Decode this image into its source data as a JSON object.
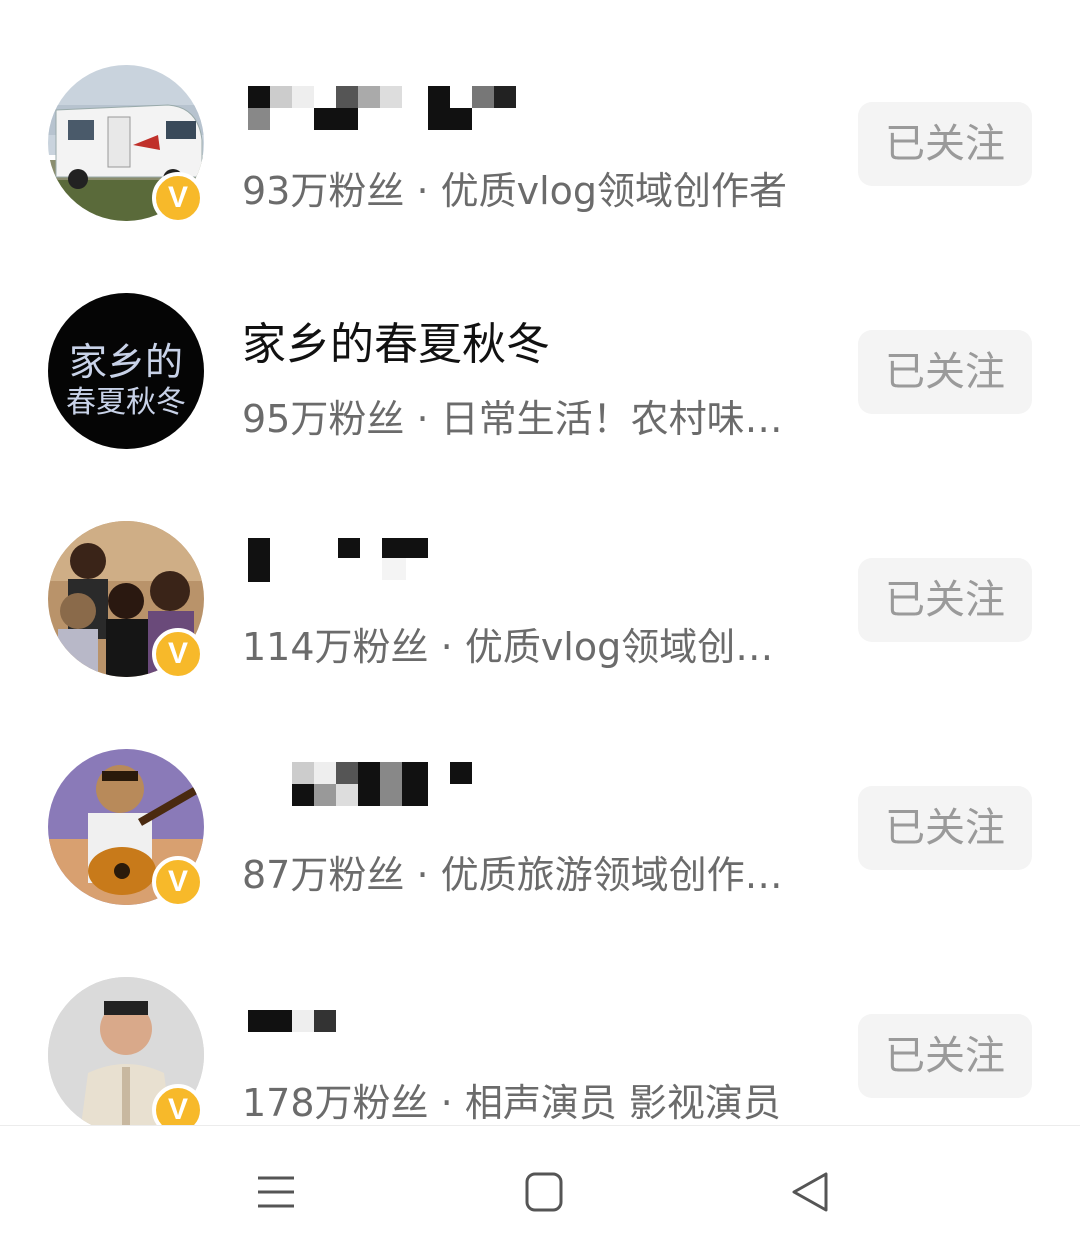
{
  "follow_list": [
    {
      "name": "",
      "followers": "93万粉丝",
      "separator": "·",
      "description": "优质vlog领域创作者",
      "verified_badge": "V",
      "follow_label": "已关注",
      "avatar_icon": "rv-camper-avatar"
    },
    {
      "name": "家乡的春夏秋冬",
      "followers": "95万粉丝",
      "separator": "·",
      "description": "日常生活！农村味…",
      "verified_badge": "",
      "follow_label": "已关注",
      "avatar_text_line1": "家乡的",
      "avatar_text_line2": "春夏秋冬"
    },
    {
      "name": "",
      "followers": "114万粉丝",
      "separator": "·",
      "description": "优质vlog领域创…",
      "verified_badge": "V",
      "follow_label": "已关注",
      "avatar_icon": "family-photo-avatar"
    },
    {
      "name": "",
      "followers": "87万粉丝",
      "separator": "·",
      "description": "优质旅游领域创作…",
      "verified_badge": "V",
      "follow_label": "已关注",
      "avatar_icon": "guitar-player-avatar"
    },
    {
      "name": "",
      "followers": "178万粉丝",
      "separator": "·",
      "description": "相声演员 影视演员",
      "verified_badge": "V",
      "follow_label": "已关注",
      "avatar_icon": "performer-portrait-avatar"
    }
  ],
  "nav": {
    "menu_icon": "menu-icon",
    "home_icon": "home-square-icon",
    "back_icon": "back-triangle-icon"
  },
  "colors": {
    "badge": "#f7b92a",
    "button_bg": "#f4f4f4",
    "button_text": "#9a9a9a",
    "meta_text": "#6b6b6b"
  }
}
